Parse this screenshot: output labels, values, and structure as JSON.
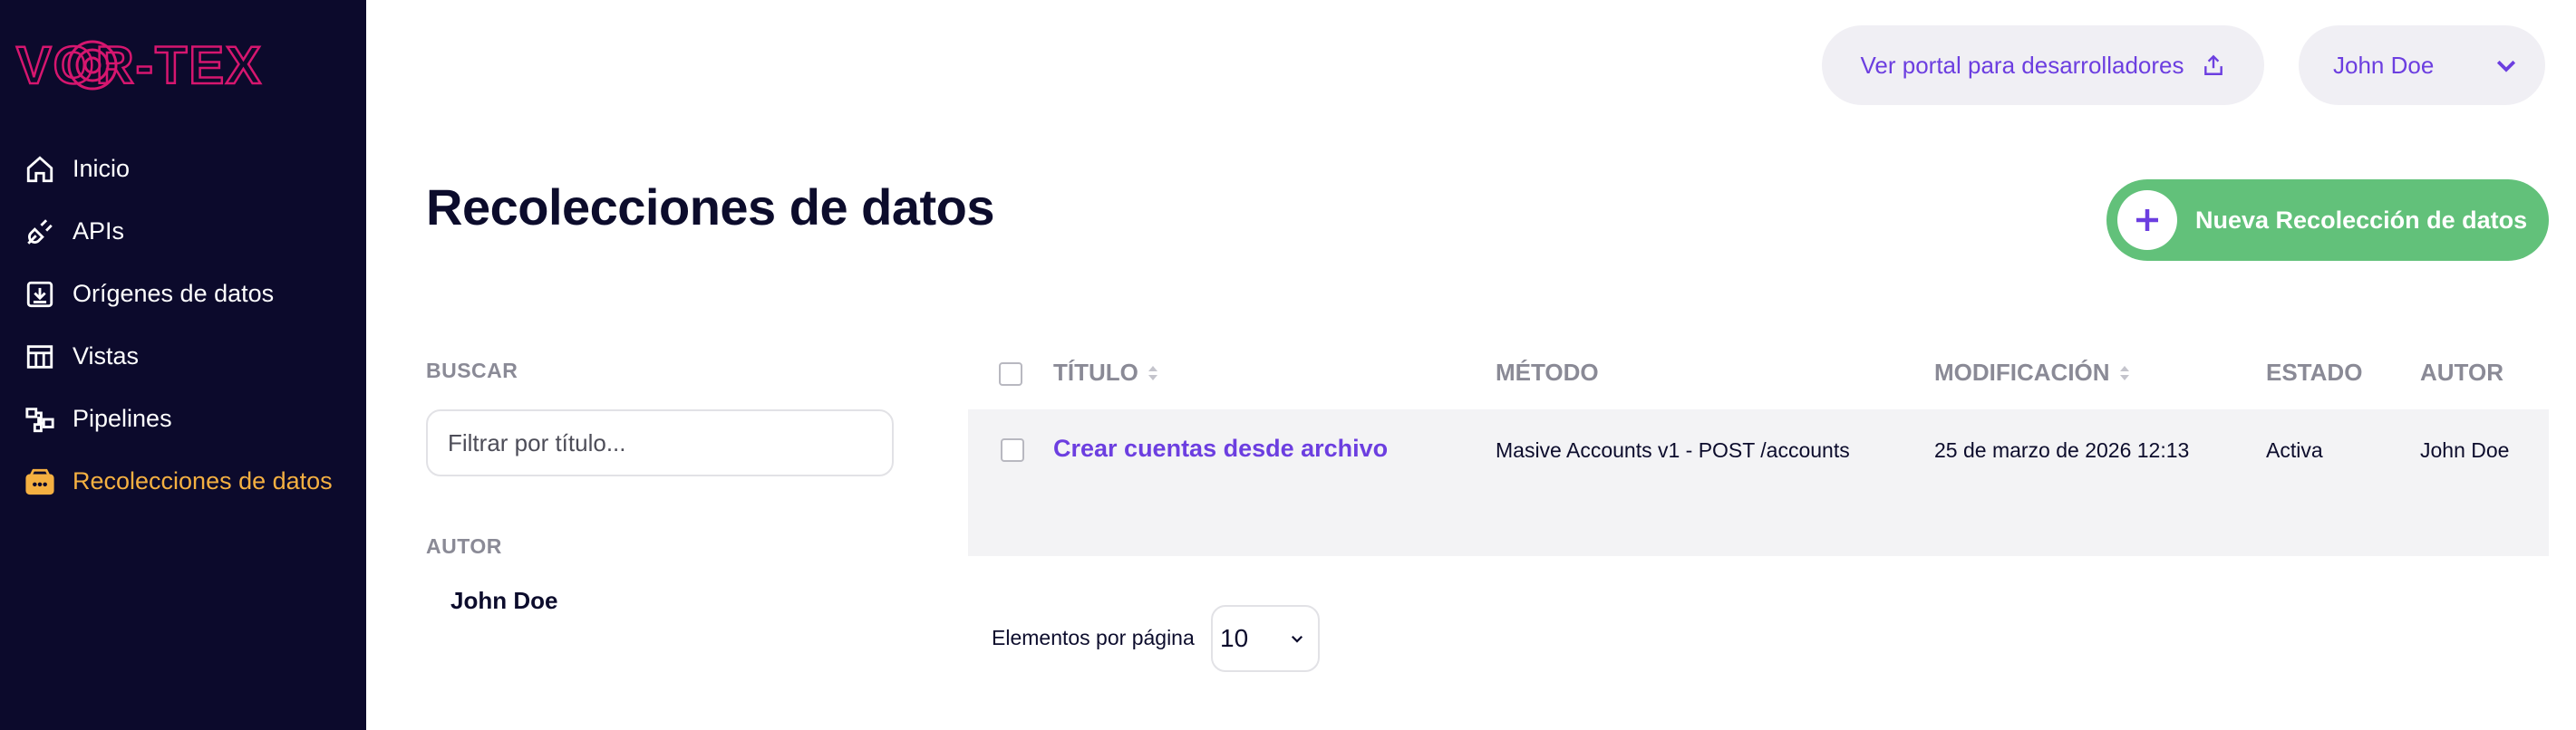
{
  "brand": {
    "logo_text": "VOR-TEX"
  },
  "sidebar": {
    "items": [
      {
        "label": "Inicio",
        "icon": "home-icon"
      },
      {
        "label": "APIs",
        "icon": "plug-icon"
      },
      {
        "label": "Orígenes de datos",
        "icon": "download-icon"
      },
      {
        "label": "Vistas",
        "icon": "table-icon"
      },
      {
        "label": "Pipelines",
        "icon": "pipeline-icon"
      },
      {
        "label": "Recolecciones de datos",
        "icon": "collection-icon",
        "active": true
      }
    ]
  },
  "header": {
    "portal_label": "Ver portal para desarrolladores",
    "user_name": "John Doe"
  },
  "page": {
    "title": "Recolecciones de datos",
    "new_button_label": "Nueva Recolección de datos"
  },
  "filters": {
    "search_label": "BUSCAR",
    "search_placeholder": "Filtrar por título...",
    "author_label": "AUTOR",
    "author_option": "John Doe"
  },
  "table": {
    "columns": [
      "TÍTULO",
      "MÉTODO",
      "MODIFICACIÓN",
      "ESTADO",
      "AUTOR"
    ],
    "rows": [
      {
        "title": "Crear cuentas desde archivo",
        "method": "Masive Accounts v1 - POST /accounts",
        "modified": "25 de marzo de 2026 12:13",
        "status": "Activa",
        "author": "John Doe"
      }
    ]
  },
  "pagination": {
    "label": "Elementos por página",
    "value": "10"
  },
  "colors": {
    "sidebar_bg": "#0c0a2c",
    "accent_purple": "#6c3ee0",
    "active_orange": "#f5b041",
    "green": "#62c17a",
    "logo_magenta": "#d6166f"
  }
}
